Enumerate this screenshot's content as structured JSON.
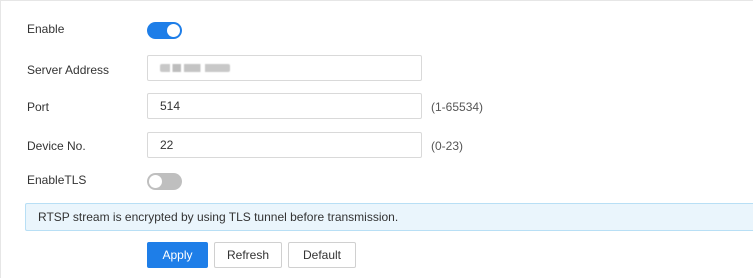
{
  "form": {
    "enable": {
      "label": "Enable",
      "state": "on"
    },
    "server_address": {
      "label": "Server Address",
      "value_redacted": true
    },
    "port": {
      "label": "Port",
      "value": "514",
      "range": "(1-65534)"
    },
    "device_no": {
      "label": "Device No.",
      "value": "22",
      "range": "(0-23)"
    },
    "enable_tls": {
      "label": "EnableTLS",
      "state": "off"
    }
  },
  "notice": "RTSP stream is encrypted by using TLS tunnel before transmission.",
  "buttons": {
    "apply": "Apply",
    "refresh": "Refresh",
    "default": "Default"
  },
  "colors": {
    "accent": "#1e7ee8",
    "toggle_off": "#bfbfbf",
    "notice_bg": "#eaf5fc",
    "notice_border": "#b8dff5"
  }
}
